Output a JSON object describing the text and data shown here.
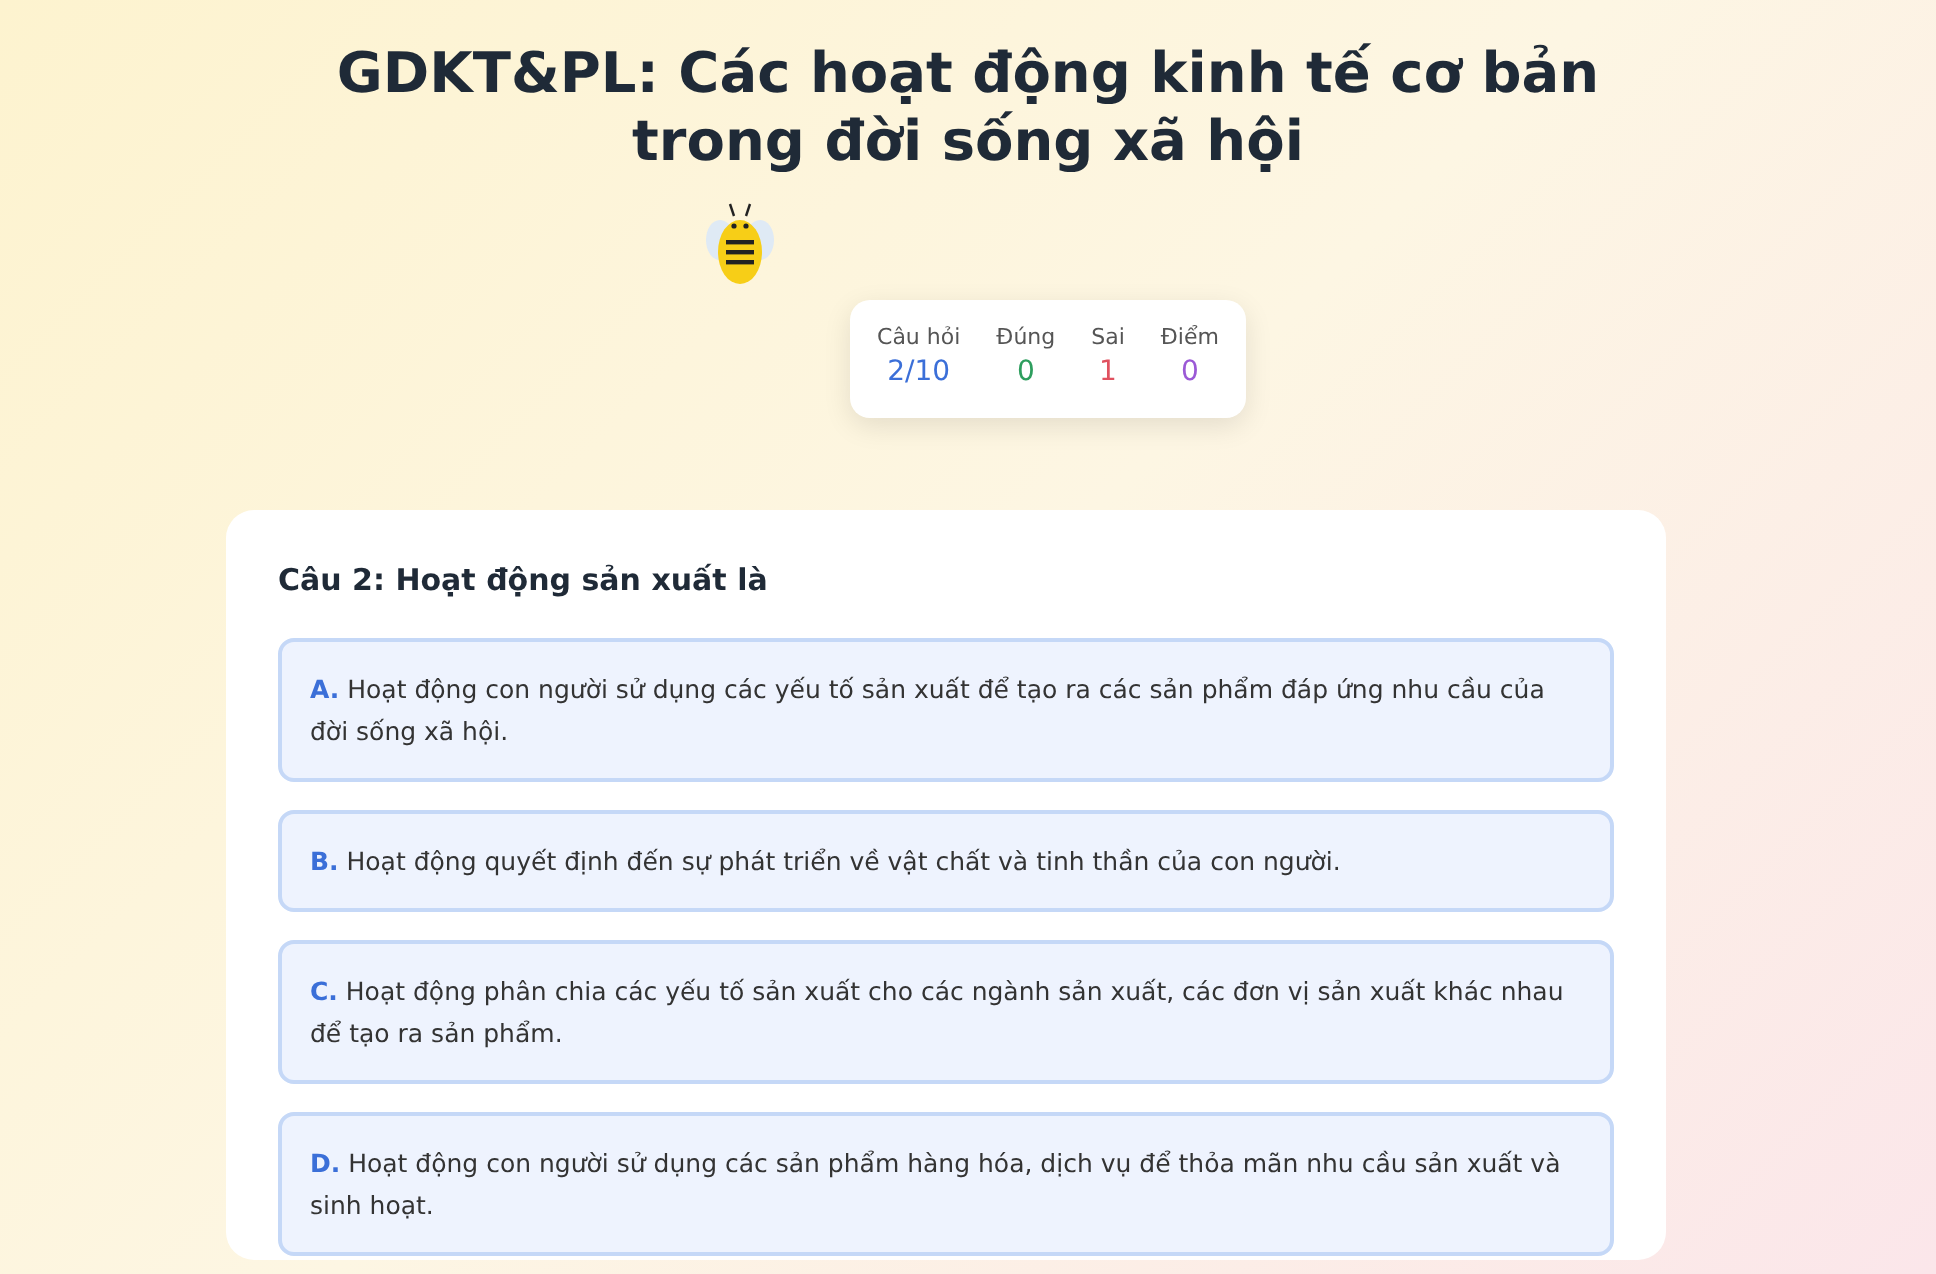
{
  "title": "GDKT&PL: Các hoạt động kinh tế cơ bản trong đời sống xã hội",
  "stats": [
    {
      "label": "Câu hỏi",
      "value": "2/10",
      "color": "#3b6fd8"
    },
    {
      "label": "Đúng",
      "value": "0",
      "color": "#2e9e5e"
    },
    {
      "label": "Sai",
      "value": "1",
      "color": "#e0515f"
    },
    {
      "label": "Điểm",
      "value": "0",
      "color": "#9b59d6"
    }
  ],
  "question": "Câu 2: Hoạt động sản xuất là",
  "answers": [
    {
      "letter": "A.",
      "text": "Hoạt động con người sử dụng các yếu tố sản xuất để tạo ra các sản phẩm đáp ứng nhu cầu của đời sống xã hội."
    },
    {
      "letter": "B.",
      "text": "Hoạt động quyết định đến sự phát triển về vật chất và tinh thần của con người."
    },
    {
      "letter": "C.",
      "text": "Hoạt động phân chia các yếu tố sản xuất cho các ngành sản xuất, các đơn vị sản xuất khác nhau để tạo ra sản phẩm."
    },
    {
      "letter": "D.",
      "text": "Hoạt động con người sử dụng các sản phẩm hàng hóa, dịch vụ để thỏa mãn nhu cầu sản xuất và sinh hoạt."
    }
  ]
}
